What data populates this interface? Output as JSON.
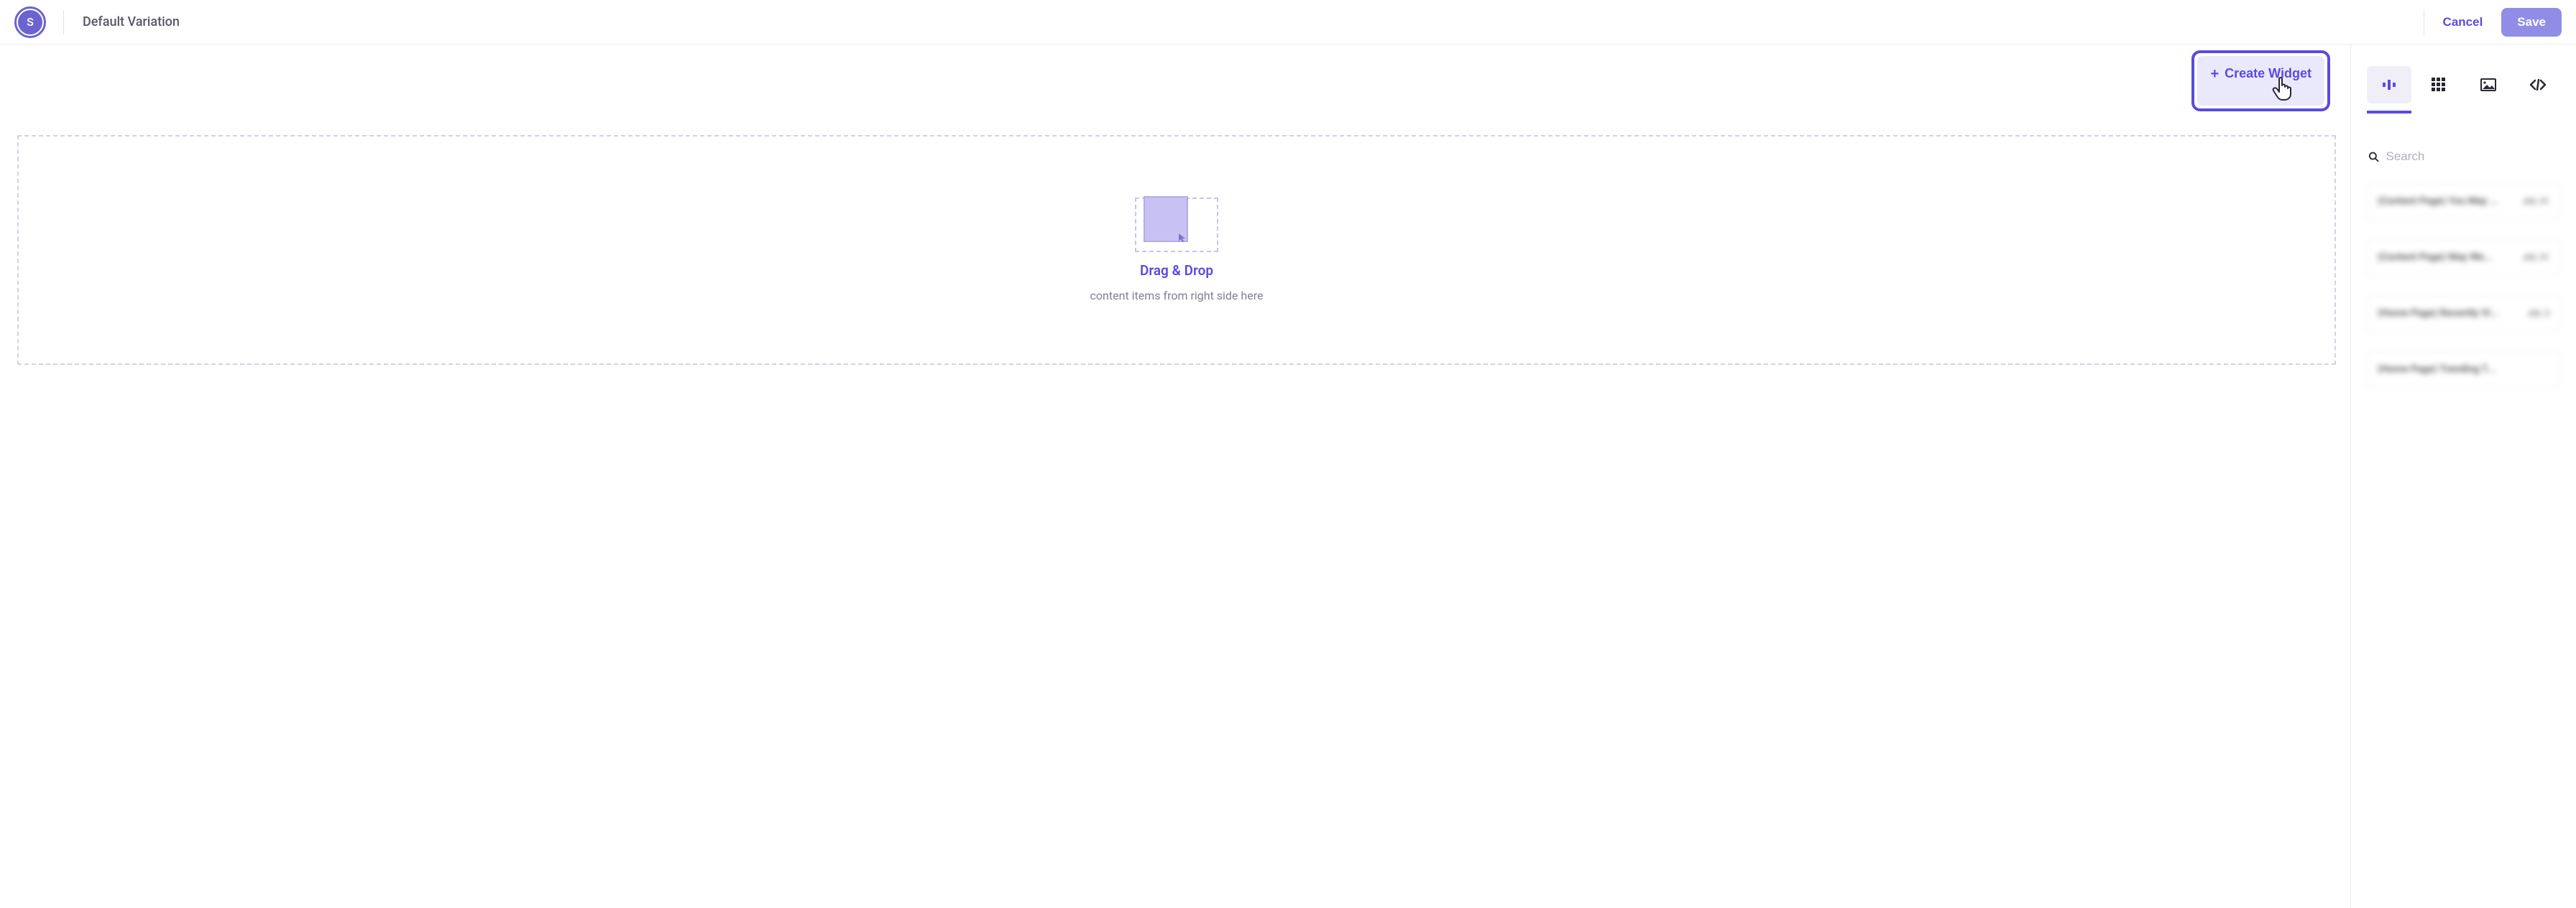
{
  "topbar": {
    "avatar_letter": "S",
    "page_title": "Default Variation",
    "cancel_label": "Cancel",
    "save_label": "Save"
  },
  "canvas": {
    "create_widget_label": "Create Widget",
    "drop_title": "Drag & Drop",
    "drop_sub": "content items from right side here"
  },
  "sidebar": {
    "tabs": [
      {
        "id": "layout",
        "icon": "layout-icon",
        "active": true
      },
      {
        "id": "grid",
        "icon": "grid-icon",
        "active": false
      },
      {
        "id": "image",
        "icon": "image-icon",
        "active": false
      },
      {
        "id": "code",
        "icon": "code-icon",
        "active": false
      }
    ],
    "search_placeholder": "Search",
    "items": [
      {
        "title": "(Content Page) You May ...",
        "meta": "JUL 31"
      },
      {
        "title": "(Content Page) May We...",
        "meta": "JUL 31"
      },
      {
        "title": "(Home Page) Recently Vi...",
        "meta": "JUL 3"
      },
      {
        "title": "(Home Page) Trending T...",
        "meta": ""
      }
    ]
  }
}
